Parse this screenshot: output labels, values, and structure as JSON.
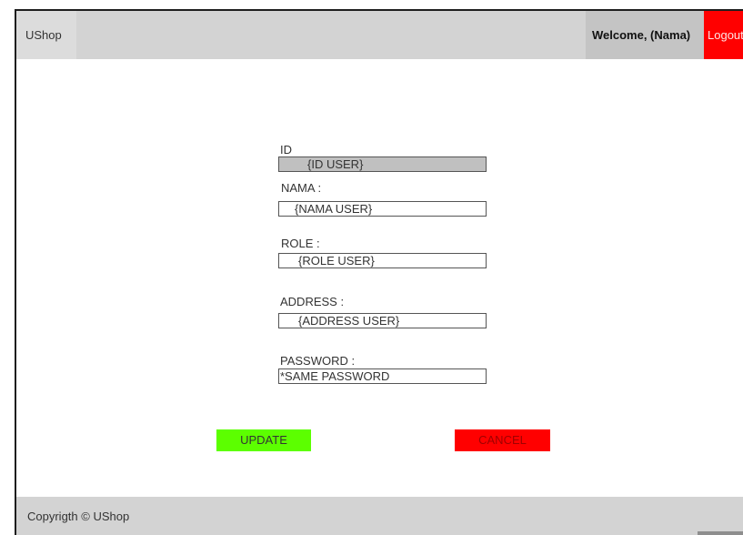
{
  "header": {
    "brand": "UShop",
    "welcome": "Welcome, (Nama)",
    "logout_label": "Logout"
  },
  "form": {
    "id_label": "ID",
    "id_value": "{ID USER}",
    "nama_label": "NAMA :",
    "nama_value": "{NAMA USER}",
    "role_label": "ROLE :",
    "role_value": "{ROLE USER}",
    "address_label": "ADDRESS :",
    "address_value": "{ADDRESS USER}",
    "password_label": "PASSWORD :",
    "password_value": "*SAME PASSWORD"
  },
  "actions": {
    "update_label": "UPDATE",
    "cancel_label": "CANCEL"
  },
  "footer": {
    "copyright": "Copyrigth © UShop"
  },
  "colors": {
    "update": "#5cff00",
    "cancel": "#ff0000",
    "logout": "#ff0000",
    "bar": "#d3d3d3"
  }
}
